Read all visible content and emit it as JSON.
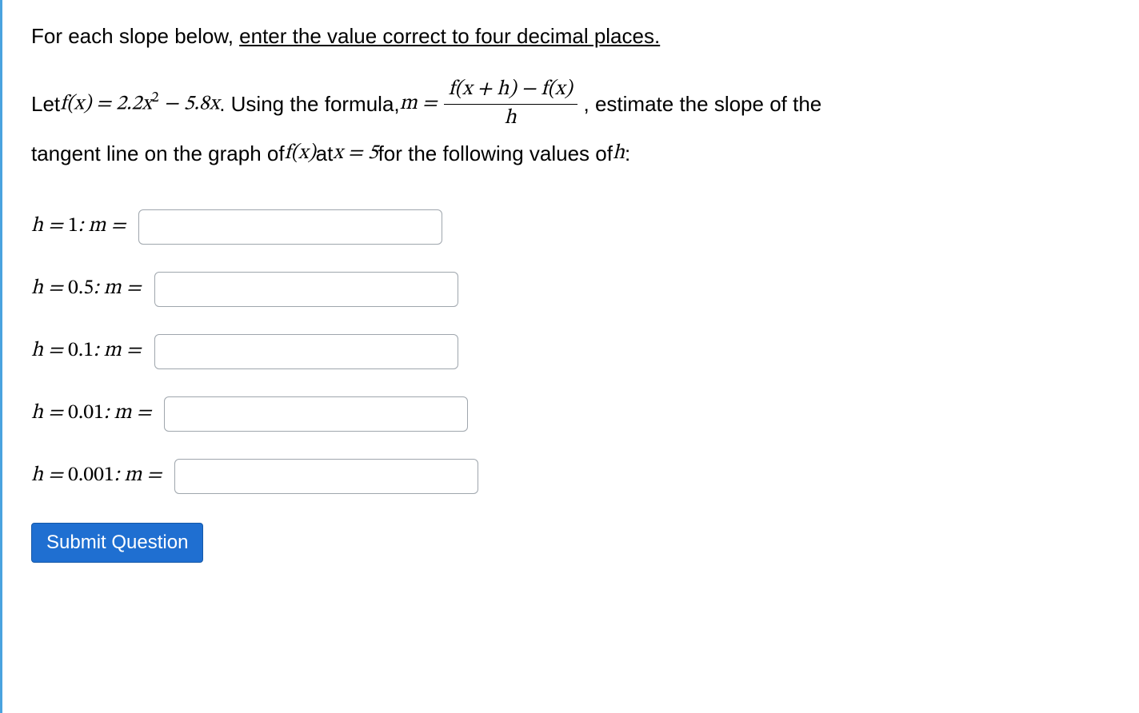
{
  "intro": {
    "lead": "For each slope below, ",
    "underlined": "enter the value correct to four decimal places."
  },
  "problem": {
    "line1_pre": "Let ",
    "fx_eq": "f(x) = 2.2x",
    "fx_exp": "2",
    "fx_tail": " − 5.8x",
    "line1_mid": ". Using the formula, ",
    "m_eq": "m =",
    "frac_num": "f(x + h) − f(x)",
    "frac_den": "h",
    "line1_post": ", estimate the slope of the",
    "line2_pre": "tangent line on the graph of ",
    "line2_fx": "f(x)",
    "line2_mid": " at ",
    "line2_x_eq": "x = 5",
    "line2_post": " for the following values of ",
    "line2_h": "h",
    "line2_end": ":"
  },
  "rows": [
    {
      "h": "1",
      "label_pre": "h = ",
      "label_mid": "1",
      "label_post": ":   m = ",
      "value": ""
    },
    {
      "h": "0.5",
      "label_pre": "h = ",
      "label_mid": "0.5",
      "label_post": ":   m = ",
      "value": ""
    },
    {
      "h": "0.1",
      "label_pre": "h = ",
      "label_mid": "0.1",
      "label_post": ":   m = ",
      "value": ""
    },
    {
      "h": "0.01",
      "label_pre": "h = ",
      "label_mid": "0.01",
      "label_post": ":   m = ",
      "value": ""
    },
    {
      "h": "0.001",
      "label_pre": "h = ",
      "label_mid": "0.001",
      "label_post": ":   m = ",
      "value": ""
    }
  ],
  "submit_label": "Submit Question"
}
